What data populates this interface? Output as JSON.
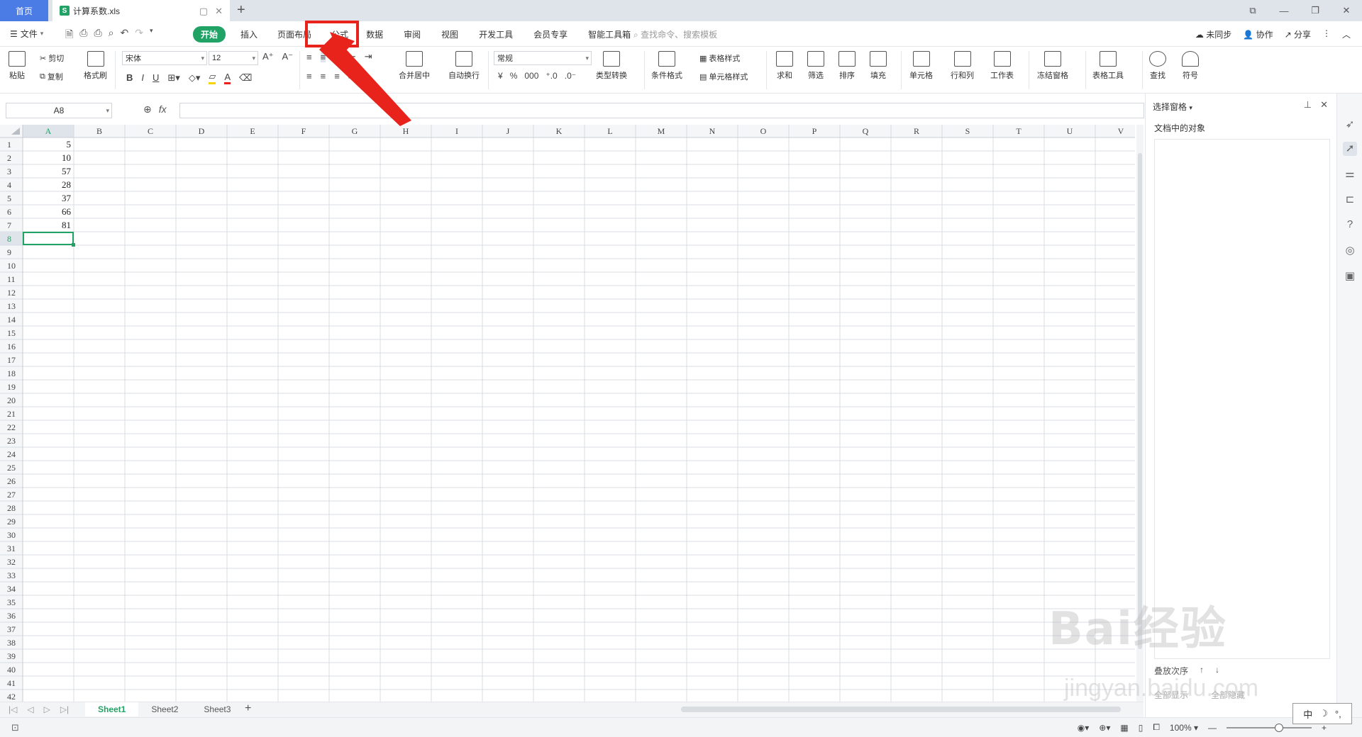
{
  "tabs": {
    "home": "首页",
    "doc_icon": "S",
    "doc_title": "计算系数.xls"
  },
  "menu": {
    "file": "文件",
    "tabs": [
      "开始",
      "插入",
      "页面布局",
      "公式",
      "数据",
      "审阅",
      "视图",
      "开发工具",
      "会员专享",
      "智能工具箱"
    ],
    "search_placeholder": "查找命令、搜索模板",
    "unsynced": "未同步",
    "collaborate": "协作",
    "share": "分享"
  },
  "ribbon": {
    "paste": "粘贴",
    "cut": "剪切",
    "copy": "复制",
    "format_painter": "格式刷",
    "font_name": "宋体",
    "font_size": "12",
    "merge_center": "合并居中",
    "wrap_text": "自动换行",
    "number_format": "常规",
    "type_convert": "类型转换",
    "cond_format": "条件格式",
    "table_style": "表格样式",
    "cell_style": "单元格样式",
    "sum": "求和",
    "filter": "筛选",
    "sort": "排序",
    "fill": "填充",
    "cell": "单元格",
    "row_col": "行和列",
    "worksheet": "工作表",
    "freeze": "冻结窗格",
    "table_tools": "表格工具",
    "find": "查找",
    "symbol": "符号",
    "currency": "¥",
    "percent": "%",
    "thousands": "000"
  },
  "formula_bar": {
    "name_box": "A8",
    "fx": "fx",
    "value": ""
  },
  "sheet": {
    "columns": [
      "A",
      "B",
      "C",
      "D",
      "E",
      "F",
      "G",
      "H",
      "I",
      "J",
      "K",
      "L",
      "M",
      "N",
      "O",
      "P",
      "Q",
      "R",
      "S",
      "T",
      "U",
      "V"
    ],
    "row_count": 42,
    "values": {
      "1": "5",
      "2": "10",
      "3": "57",
      "4": "28",
      "5": "37",
      "6": "66",
      "7": "81"
    },
    "selected_row": 8,
    "selected_col": "A",
    "accent": "#21a366"
  },
  "sheets": [
    "Sheet1",
    "Sheet2",
    "Sheet3"
  ],
  "panel": {
    "title": "选择窗格",
    "objects_label": "文档中的对象",
    "order_label": "叠放次序",
    "show_all": "全部显示",
    "hide_all": "全部隐藏"
  },
  "status": {
    "zoom": "100%",
    "ime_cn": "中"
  },
  "watermark": {
    "brand": "Bai经验",
    "url": "jingyan.baidu.com"
  }
}
